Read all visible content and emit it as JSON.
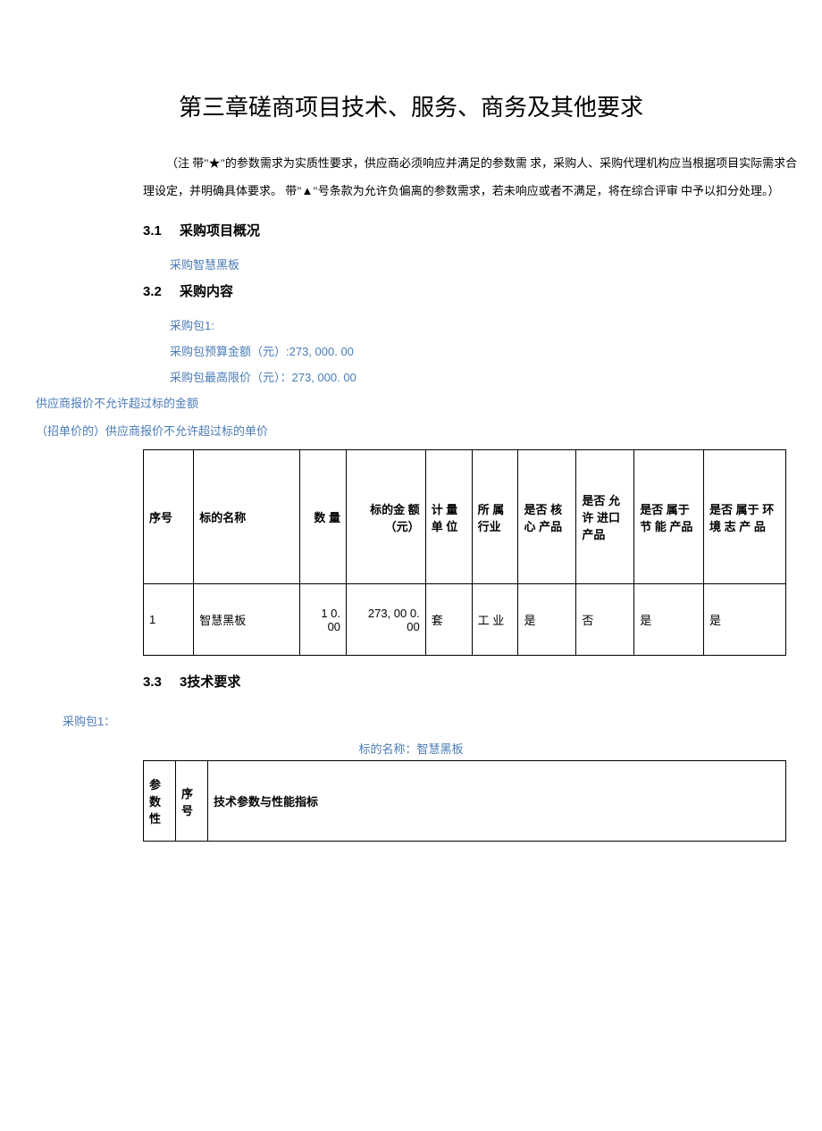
{
  "title": "第三章磋商项目技术、服务、商务及其他要求",
  "note": "（注 带\"★\"的参数需求为实质性要求，供应商必须响应并满足的参数需 求，采购人、采购代理机构应当根据项目实际需求合理设定，并明确具体要求。  带\"▲\"号条款为允许负偏离的参数需求，若未响应或者不满足，将在综合评审  中予以扣分处理。）",
  "sections": {
    "s31_num": "3.1",
    "s31_title": "采购项目概况",
    "s31_content": "采购智慧黑板",
    "s32_num": "3.2",
    "s32_title": "采购内容",
    "s32_pkg": "采购包1:",
    "s32_budget": "采购包预算金额（元）:273, 000.  00",
    "s32_limit": "采购包最高限价（元）：273,  000.  00",
    "s32_rule1": "供应商报价不允许超过标的金额",
    "s32_rule2": "（招单价的）供应商报价不允许超过标的单价",
    "s33_num": "3.3",
    "s33_title": "3技术要求",
    "s33_pkg": "采购包1：",
    "s33_subject": "标的名称：智慧黑板"
  },
  "table_headers": {
    "seq": "序号",
    "name": "标的名称",
    "qty": "数 量",
    "amt": "标的金 额（元）",
    "unit": "计 量  单 位",
    "ind": "所  属 行业",
    "core": "是否 核 心 产品",
    "imp": "是否 允许 进口 产品",
    "eco": "是否 属于 节 能  产品",
    "env": "是否 属于 环境  志  产  品"
  },
  "rows": [
    {
      "seq": "1",
      "name": "智慧黑板",
      "qty": "1 0. 00",
      "amt": "273, 00 0. 00",
      "unit": "套",
      "ind": "工 业",
      "core": "是",
      "imp": "否",
      "eco": "是",
      "env": "是"
    }
  ],
  "req_headers": {
    "param": "参 数 性",
    "seq": "序 号",
    "spec": "技术参数与性能指标"
  }
}
